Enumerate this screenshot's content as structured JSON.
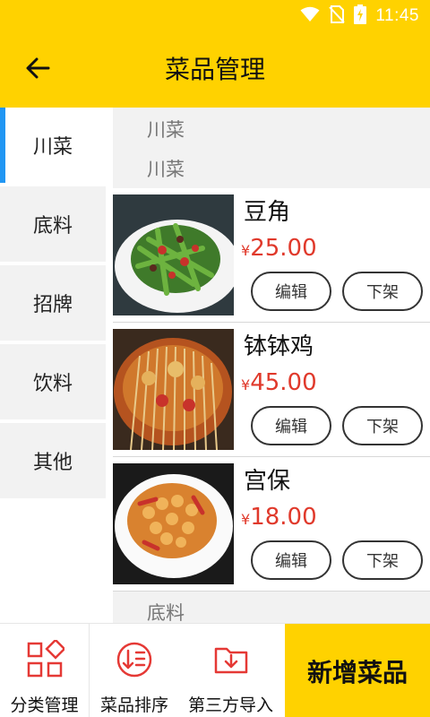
{
  "status_bar": {
    "time": "11:45",
    "icons": [
      "wifi-icon",
      "no-sim-icon",
      "battery-charging-icon"
    ]
  },
  "header": {
    "back_icon": "arrow-left-icon",
    "title": "菜品管理"
  },
  "colors": {
    "accent_yellow": "#ffd200",
    "price_red": "#e0392b",
    "active_indicator_blue": "#2196f3"
  },
  "sidebar": {
    "items": [
      {
        "label": "川菜",
        "active": true
      },
      {
        "label": "底料",
        "active": false
      },
      {
        "label": "招牌",
        "active": false
      },
      {
        "label": "饮料",
        "active": false
      },
      {
        "label": "其他",
        "active": false
      }
    ]
  },
  "list": {
    "section_1": {
      "header_line_1": "川菜",
      "header_line_2": "川菜"
    },
    "dishes": [
      {
        "name": "豆角",
        "currency": "¥",
        "price": "25.00",
        "edit_label": "编辑",
        "off_label": "下架"
      },
      {
        "name": "钵钵鸡",
        "currency": "¥",
        "price": "45.00",
        "edit_label": "编辑",
        "off_label": "下架"
      },
      {
        "name": "宫保",
        "currency": "¥",
        "price": "18.00",
        "edit_label": "编辑",
        "off_label": "下架"
      }
    ],
    "section_2": {
      "header_line_1": "底料"
    }
  },
  "bottom_bar": {
    "tools": [
      {
        "label": "分类管理",
        "icon": "category-grid-icon"
      },
      {
        "label": "菜品排序",
        "icon": "sort-icon"
      },
      {
        "label": "第三方导入",
        "icon": "folder-import-icon"
      }
    ],
    "add_label": "新增菜品"
  }
}
